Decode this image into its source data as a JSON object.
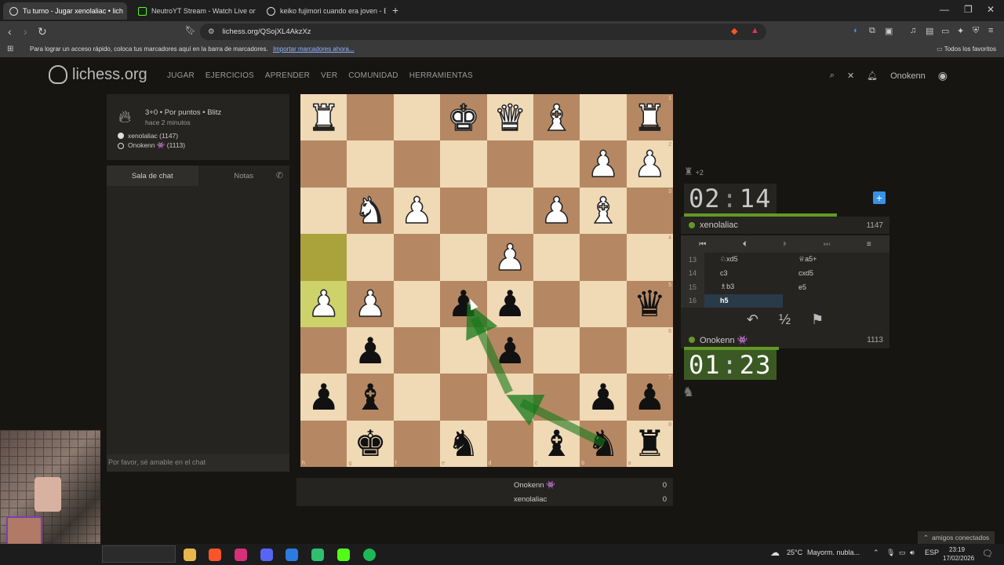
{
  "browser": {
    "tabs": [
      {
        "title": "Tu turno - Jugar xenolaliac • lich",
        "active": true
      },
      {
        "title": "NeutroYT Stream - Watch Live on",
        "active": false
      },
      {
        "title": "keiko fujimori cuando era joven - Bus",
        "active": false
      }
    ],
    "url": "lichess.org/QSojXL4AkzXz",
    "bookmarks_msg": "Para lograr un acceso rápido, coloca tus marcadores aquí en la barra de marcadores.",
    "bookmarks_link": "Importar marcadores ahora...",
    "bookmarks_right": "Todos los favoritos"
  },
  "site": {
    "logo": "lichess.org",
    "nav": [
      "JUGAR",
      "EJERCICIOS",
      "APRENDER",
      "VER",
      "COMUNIDAD",
      "HERRAMIENTAS"
    ],
    "username": "Onokenn"
  },
  "game": {
    "setup": "3+0 • Por puntos • Blitz",
    "ago": "hace 2 minutos",
    "white_player": "xenolaliac (1147)",
    "black_player": "Onokenn 👾 (1113)"
  },
  "chat": {
    "tab_chat": "Sala de chat",
    "tab_notes": "Notas",
    "placeholder": "Por favor, sé amable en el chat"
  },
  "board": {
    "files_bottom": [
      "h",
      "g",
      "f",
      "e",
      "d",
      "c",
      "b",
      "a"
    ],
    "ranks_right": [
      "1",
      "2",
      "3",
      "4",
      "5",
      "6",
      "7",
      "8"
    ],
    "squares": [
      [
        "♜w",
        "",
        "",
        "♚w",
        "♛w",
        "♝w",
        "",
        "♜w"
      ],
      [
        "",
        "",
        "",
        "",
        "",
        "",
        "♟w",
        "♟w"
      ],
      [
        "",
        "♞w",
        "♟w",
        "",
        "",
        "♟w",
        "♝w",
        ""
      ],
      [
        "",
        "",
        "",
        "",
        "♟w",
        "",
        "",
        ""
      ],
      [
        "♟w",
        "♟w",
        "",
        "♟b",
        "♟b",
        "",
        "",
        "♛b"
      ],
      [
        "",
        "♟b",
        "",
        "",
        "♟b",
        "",
        "",
        ""
      ],
      [
        "♟b",
        "♝b",
        "",
        "",
        "",
        "",
        "♟b",
        "♟b"
      ],
      [
        "",
        "♚b",
        "",
        "♞b",
        "",
        "♝b",
        "♞b",
        "♜b"
      ]
    ]
  },
  "score": {
    "rows": [
      {
        "name": "Onokenn 👾",
        "value": "0"
      },
      {
        "name": "xenolaliac",
        "value": "0"
      }
    ]
  },
  "panel": {
    "captured": "+2",
    "opponent_clock_min": "02",
    "opponent_clock_sec": "14",
    "opponent_name": "xenolaliac",
    "opponent_rating": "1147",
    "my_clock_min": "01",
    "my_clock_sec": "23",
    "my_name": "Onokenn 👾",
    "my_rating": "1113",
    "moves": [
      {
        "n": "13",
        "w": "♘xd5",
        "b": "♕a5+"
      },
      {
        "n": "14",
        "w": "c3",
        "b": "cxd5"
      },
      {
        "n": "15",
        "w": "♗b3",
        "b": "e5"
      },
      {
        "n": "16",
        "w": "h5",
        "b": ""
      }
    ],
    "draw_label": "½"
  },
  "taskbar": {
    "weather": "25°C",
    "weather_desc": "Mayorm. nubla...",
    "lang": "ESP",
    "time": "23:19",
    "date": "17/02/2026",
    "friends": "amigos conectados"
  }
}
